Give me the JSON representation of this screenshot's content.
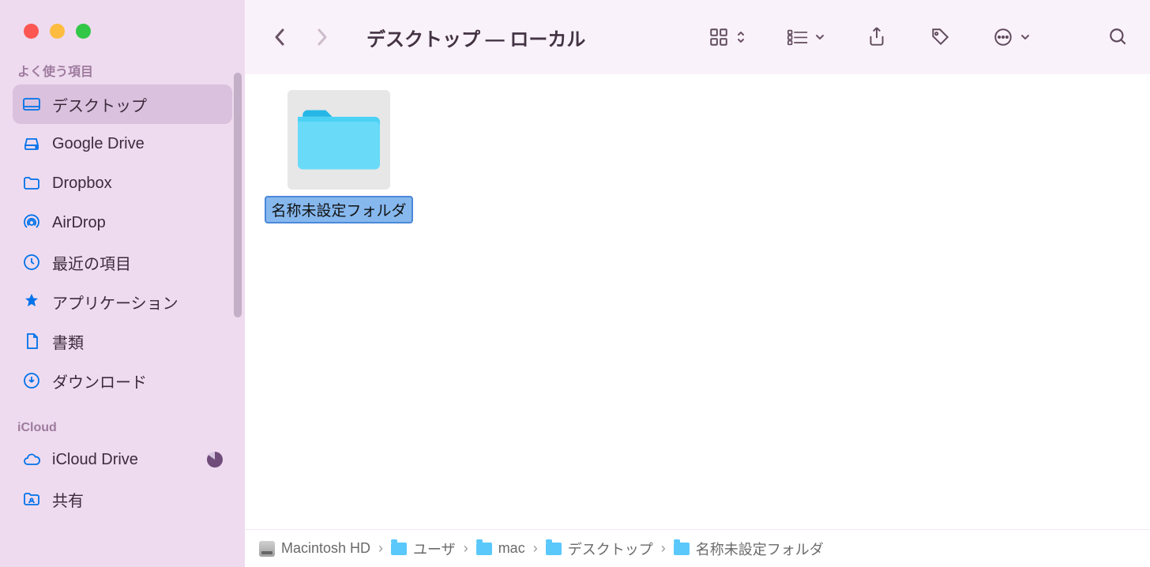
{
  "window": {
    "title": "デスクトップ — ローカル"
  },
  "sidebar": {
    "sections": [
      {
        "title": "よく使う項目",
        "items": [
          {
            "icon": "desktop",
            "label": "デスクトップ",
            "selected": true
          },
          {
            "icon": "gdrive",
            "label": "Google Drive"
          },
          {
            "icon": "folder",
            "label": "Dropbox"
          },
          {
            "icon": "airdrop",
            "label": "AirDrop"
          },
          {
            "icon": "clock",
            "label": "最近の項目"
          },
          {
            "icon": "app",
            "label": "アプリケーション"
          },
          {
            "icon": "doc",
            "label": "書類"
          },
          {
            "icon": "download",
            "label": "ダウンロード"
          }
        ]
      },
      {
        "title": "iCloud",
        "items": [
          {
            "icon": "cloud",
            "label": "iCloud Drive",
            "badge": "progress"
          },
          {
            "icon": "shared",
            "label": "共有"
          }
        ]
      }
    ]
  },
  "files": [
    {
      "name": "名称未設定フォルダ",
      "type": "folder",
      "selected": true
    }
  ],
  "pathbar": [
    {
      "icon": "disk",
      "label": "Macintosh HD"
    },
    {
      "icon": "folder",
      "label": "ユーザ"
    },
    {
      "icon": "folder",
      "label": "mac"
    },
    {
      "icon": "folder",
      "label": "デスクトップ"
    },
    {
      "icon": "folder",
      "label": "名称未設定フォルダ"
    }
  ]
}
